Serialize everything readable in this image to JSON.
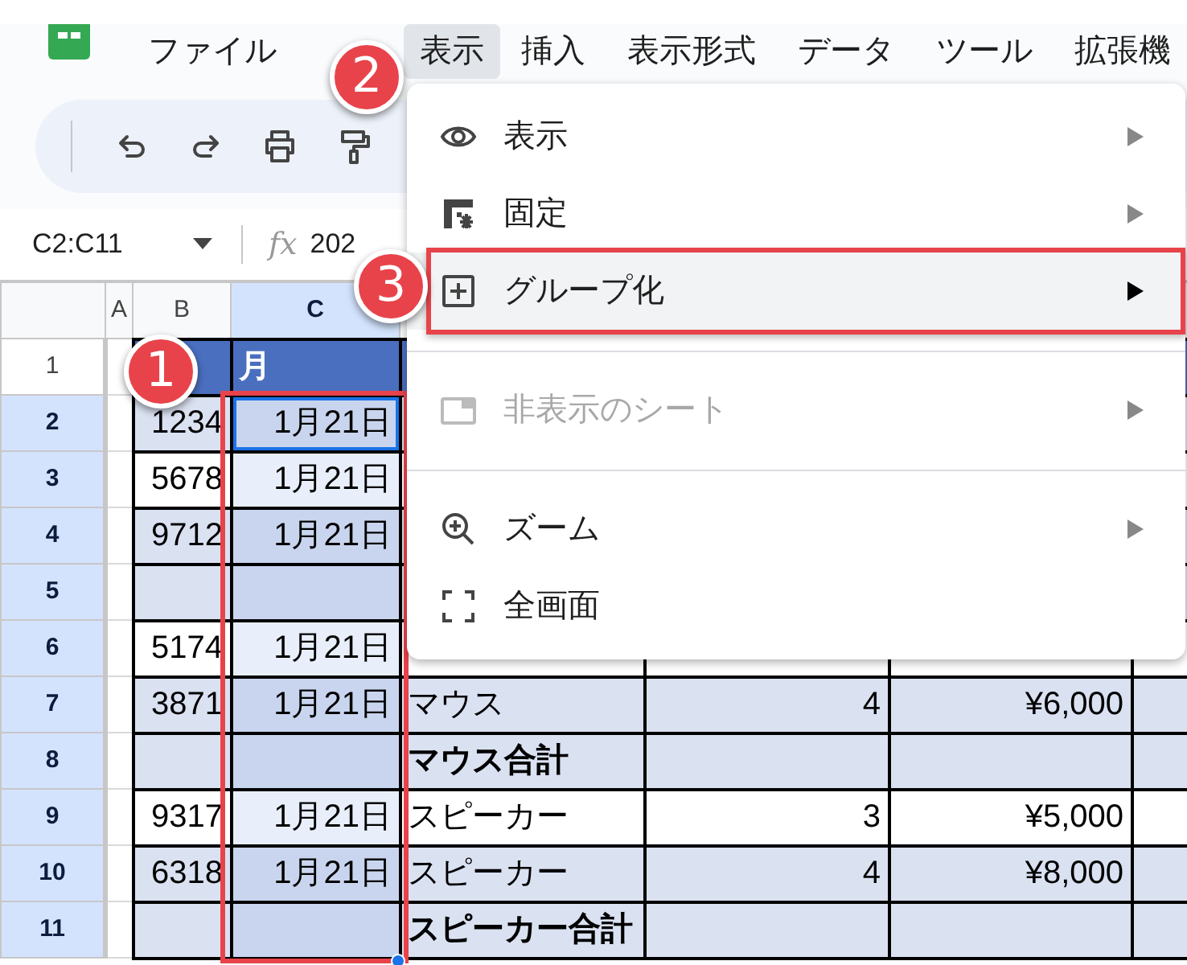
{
  "menu_bar": [
    {
      "label": "ファイル",
      "selected": false
    },
    {
      "label": "表示",
      "selected": true
    },
    {
      "label": "挿入",
      "selected": false
    },
    {
      "label": "表示形式",
      "selected": false
    },
    {
      "label": "データ",
      "selected": false
    },
    {
      "label": "ツール",
      "selected": false
    },
    {
      "label": "拡張機",
      "selected": false
    }
  ],
  "formula_bar": {
    "name_box": "C2:C11",
    "fx_label": "fx",
    "formula": "202"
  },
  "grid": {
    "columns": [
      {
        "label": "A",
        "selected": false
      },
      {
        "label": "B",
        "selected": false
      },
      {
        "label": "C",
        "selected": true
      }
    ],
    "outlined": true,
    "rows": [
      {
        "number": "1",
        "kind": "header",
        "selected": false,
        "cells": {
          "C": "月"
        }
      },
      {
        "number": "2",
        "kind": "data",
        "selected": true,
        "banded": true,
        "cells": {
          "B": "1234",
          "C": "1月21日"
        }
      },
      {
        "number": "3",
        "kind": "data",
        "selected": true,
        "banded": false,
        "cells": {
          "B": "5678",
          "C": "1月21日"
        }
      },
      {
        "number": "4",
        "kind": "data",
        "selected": true,
        "banded": true,
        "cells": {
          "B": "9712",
          "C": "1月21日"
        }
      },
      {
        "number": "5",
        "kind": "data",
        "selected": true,
        "banded": true,
        "cells": {}
      },
      {
        "number": "6",
        "kind": "data",
        "selected": true,
        "banded": false,
        "cells": {
          "B": "5174",
          "C": "1月21日"
        }
      },
      {
        "number": "7",
        "kind": "data",
        "selected": true,
        "banded": true,
        "cells": {
          "B": "3871",
          "C": "1月21日",
          "D": "マウス",
          "E": "4",
          "F": "¥6,000"
        }
      },
      {
        "number": "8",
        "kind": "subtotal",
        "selected": true,
        "banded": true,
        "cells": {
          "D": "マウス合計"
        }
      },
      {
        "number": "9",
        "kind": "data",
        "selected": true,
        "banded": false,
        "cells": {
          "B": "9317",
          "C": "1月21日",
          "D": "スピーカー",
          "E": "3",
          "F": "¥5,000"
        }
      },
      {
        "number": "10",
        "kind": "data",
        "selected": true,
        "banded": true,
        "cells": {
          "B": "6318",
          "C": "1月21日",
          "D": "スピーカー",
          "E": "4",
          "F": "¥8,000"
        }
      },
      {
        "number": "11",
        "kind": "subtotal",
        "selected": true,
        "banded": true,
        "cells": {
          "D": "スピーカー合計"
        }
      }
    ]
  },
  "view_menu": {
    "items": [
      {
        "kind": "item",
        "label": "表示",
        "disabled": false,
        "highlighted": false,
        "submenu": true,
        "outlined": false
      },
      {
        "kind": "item",
        "label": "固定",
        "disabled": false,
        "highlighted": false,
        "submenu": true,
        "outlined": false
      },
      {
        "kind": "item",
        "label": "グループ化",
        "disabled": false,
        "highlighted": true,
        "submenu": true,
        "outlined": true
      },
      {
        "kind": "divider"
      },
      {
        "kind": "item",
        "label": "非表示のシート",
        "disabled": true,
        "highlighted": false,
        "submenu": true,
        "outlined": false
      },
      {
        "kind": "divider"
      },
      {
        "kind": "item",
        "label": "ズーム",
        "disabled": false,
        "highlighted": false,
        "submenu": true,
        "outlined": false
      },
      {
        "kind": "item",
        "label": "全画面",
        "disabled": false,
        "highlighted": false,
        "submenu": false,
        "outlined": false
      }
    ]
  },
  "callouts": [
    {
      "label": "1"
    },
    {
      "label": "2"
    },
    {
      "label": "3"
    }
  ]
}
